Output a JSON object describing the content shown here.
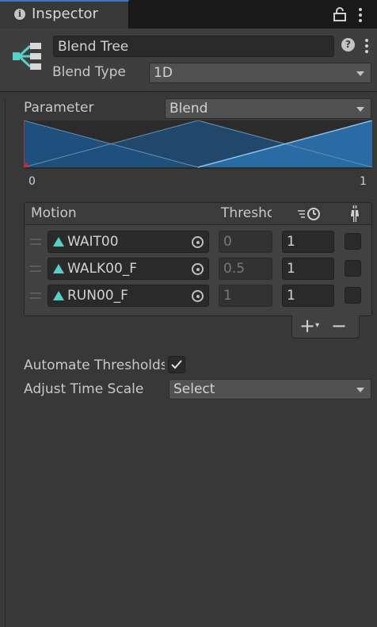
{
  "tab": {
    "title": "Inspector",
    "icon": "info-icon"
  },
  "header": {
    "name": "Blend Tree",
    "blend_type_label": "Blend Type",
    "blend_type_value": "1D"
  },
  "parameter": {
    "label": "Parameter",
    "value": "Blend"
  },
  "graph": {
    "min_label": "0",
    "max_label": "1"
  },
  "motion_list": {
    "headers": {
      "motion": "Motion",
      "threshold": "Thresho"
    },
    "rows": [
      {
        "motion": "WAIT00",
        "threshold": "0",
        "time_scale": "1"
      },
      {
        "motion": "WALK00_F",
        "threshold": "0.5",
        "time_scale": "1"
      },
      {
        "motion": "RUN00_F",
        "threshold": "1",
        "time_scale": "1"
      }
    ],
    "add_button": "+",
    "remove_button": "−"
  },
  "automate": {
    "label": "Automate Thresholds",
    "checked": true
  },
  "adjust_time_scale": {
    "label": "Adjust Time Scale",
    "value": "Select"
  },
  "colors": {
    "panel_bg": "#383838",
    "accent_blue": "#3a79bb",
    "graph_fill": "#1f4f7c",
    "graph_line": "#6fa8d8",
    "marker_red": "#d62b2b",
    "icon_teal": "#57d0c7"
  }
}
